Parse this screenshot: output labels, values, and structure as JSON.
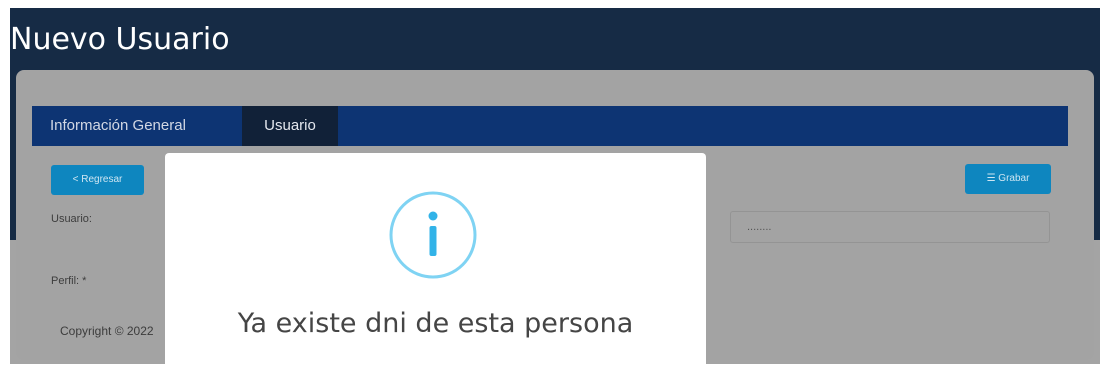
{
  "page": {
    "title": "Nuevo Usuario"
  },
  "tabs": [
    {
      "label": "Información General",
      "active": false
    },
    {
      "label": "Usuario",
      "active": true
    }
  ],
  "toolbar": {
    "back_label": "< Regresar",
    "save_label": "☰ Grabar"
  },
  "form": {
    "usuario_label": "Usuario:",
    "perfil_label": "Perfil: *",
    "password_value": "........"
  },
  "footer": {
    "copyright": "Copyright © 2022"
  },
  "modal": {
    "icon": "info-icon",
    "message": "Ya existe dni de esta persona"
  },
  "colors": {
    "header": "#162b45",
    "tabbar": "#0d3473",
    "button": "#0e86bf",
    "info_icon": "#7fd3f3"
  }
}
